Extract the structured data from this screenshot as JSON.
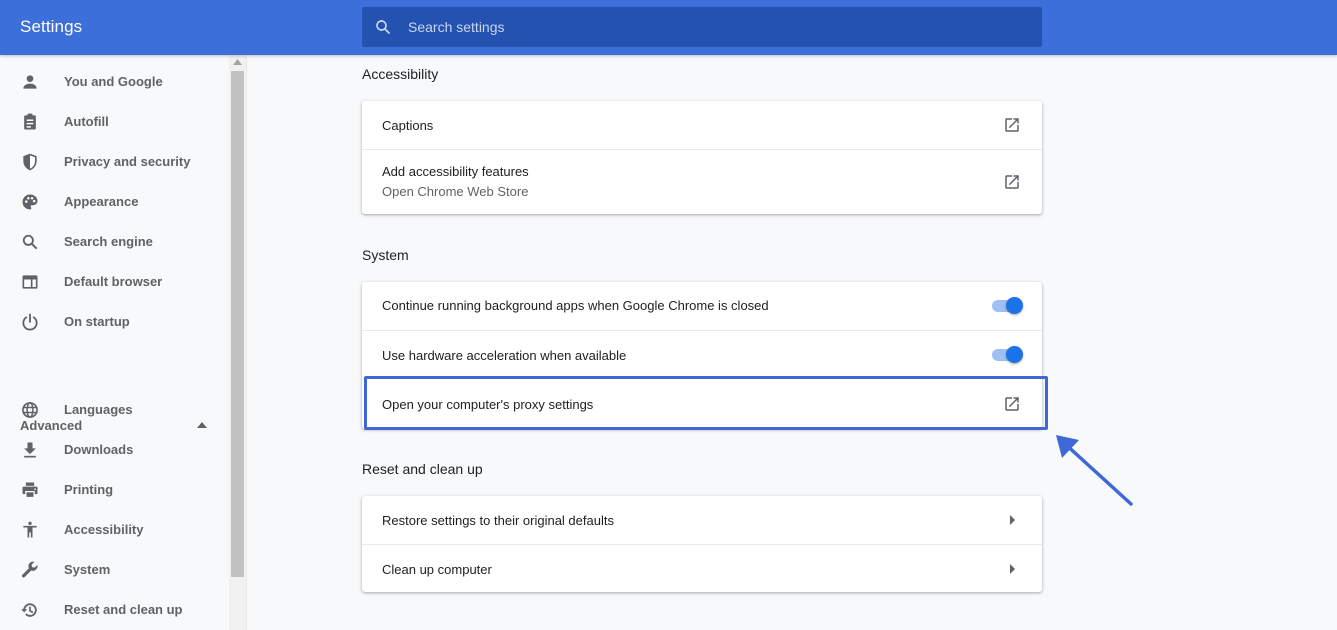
{
  "header": {
    "title": "Settings",
    "search_placeholder": "Search settings",
    "search_value": ""
  },
  "sidebar": {
    "items": [
      {
        "label": "You and Google",
        "icon": "person-icon"
      },
      {
        "label": "Autofill",
        "icon": "clipboard-icon"
      },
      {
        "label": "Privacy and security",
        "icon": "shield-icon"
      },
      {
        "label": "Appearance",
        "icon": "palette-icon"
      },
      {
        "label": "Search engine",
        "icon": "search-icon"
      },
      {
        "label": "Default browser",
        "icon": "browser-icon"
      },
      {
        "label": "On startup",
        "icon": "power-icon"
      }
    ],
    "advanced_label": "Advanced",
    "advanced_items": [
      {
        "label": "Languages",
        "icon": "globe-icon"
      },
      {
        "label": "Downloads",
        "icon": "download-icon"
      },
      {
        "label": "Printing",
        "icon": "printer-icon"
      },
      {
        "label": "Accessibility",
        "icon": "accessibility-icon"
      },
      {
        "label": "System",
        "icon": "wrench-icon"
      },
      {
        "label": "Reset and clean up",
        "icon": "history-icon"
      }
    ]
  },
  "main": {
    "accessibility": {
      "title": "Accessibility",
      "captions": "Captions",
      "add_features": "Add accessibility features",
      "add_features_sub": "Open Chrome Web Store"
    },
    "system": {
      "title": "System",
      "background_apps": "Continue running background apps when Google Chrome is closed",
      "background_apps_enabled": true,
      "hardware_accel": "Use hardware acceleration when available",
      "hardware_accel_enabled": true,
      "proxy": "Open your computer's proxy settings"
    },
    "reset": {
      "title": "Reset and clean up",
      "restore": "Restore settings to their original defaults",
      "cleanup": "Clean up computer"
    }
  },
  "colors": {
    "header_bg": "#3c6fd9",
    "search_bg": "#2452b0",
    "toggle_on": "#1a73e8",
    "highlight": "#3f67d6"
  }
}
